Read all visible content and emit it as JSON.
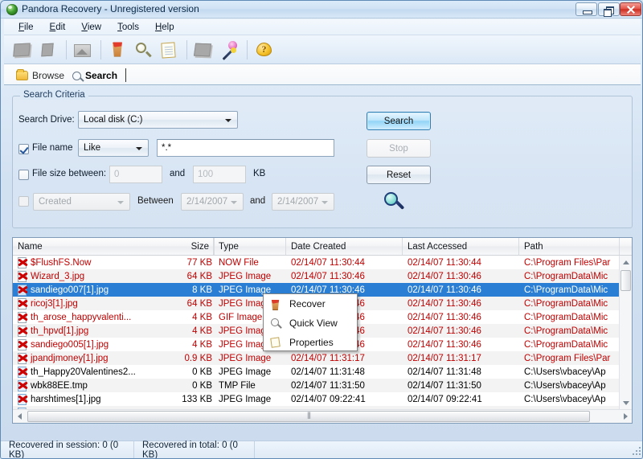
{
  "window": {
    "title": "Pandora Recovery - Unregistered version",
    "icon": "pandora-globe-icon",
    "controls": {
      "minimize": "minimize-button",
      "maximize": "maximize-button",
      "close": "close-button"
    }
  },
  "menubar": {
    "items": [
      "File",
      "Edit",
      "View",
      "Tools",
      "Help"
    ]
  },
  "toolbar": {
    "items": [
      {
        "name": "browse-back-icon"
      },
      {
        "name": "browse-forward-icon"
      },
      {
        "name": "preview-image-icon"
      },
      {
        "name": "recover-bin-icon"
      },
      {
        "name": "quick-view-icon"
      },
      {
        "name": "properties-icon"
      },
      {
        "name": "surface-scan-icon"
      },
      {
        "name": "wizard-wand-icon"
      },
      {
        "name": "help-icon"
      }
    ]
  },
  "tabs": [
    {
      "label": "Browse",
      "icon": "folder-icon",
      "active": false
    },
    {
      "label": "Search",
      "icon": "magnifier-icon",
      "active": true
    }
  ],
  "criteria": {
    "legend": "Search Criteria",
    "drive_label": "Search Drive:",
    "drive_value": "Local disk (C:)",
    "filename_label": "File name",
    "filename_checked": true,
    "filename_match": "Like",
    "filename_value": "*.*",
    "filesize_label": "File size between:",
    "filesize_checked": false,
    "filesize_min": "0",
    "filesize_and": "and",
    "filesize_max": "100",
    "filesize_unit": "KB",
    "date_checked": false,
    "date_field": "Created",
    "date_between": "Between",
    "date_from": "2/14/2007",
    "date_and": "and",
    "date_to": "2/14/2007",
    "buttons": {
      "search": "Search",
      "stop": "Stop",
      "reset": "Reset"
    },
    "magnifier_icon": "big-magnifier-icon"
  },
  "listview": {
    "columns": [
      "Name",
      "Size",
      "Type",
      "Date Created",
      "Last Accessed",
      "Path"
    ],
    "rows": [
      {
        "name": "$FlushFS.Now",
        "size": "77 KB",
        "type": "NOW File",
        "created": "02/14/07 11:30:44",
        "accessed": "02/14/07 11:30:44",
        "path": "C:\\Program Files\\Par",
        "deleted": true,
        "selected": false
      },
      {
        "name": "Wizard_3.jpg",
        "size": "64 KB",
        "type": "JPEG Image",
        "created": "02/14/07 11:30:46",
        "accessed": "02/14/07 11:30:46",
        "path": "C:\\ProgramData\\Mic",
        "deleted": true,
        "selected": false
      },
      {
        "name": "sandiego007[1].jpg",
        "size": "8 KB",
        "type": "JPEG Image",
        "created": "02/14/07 11:30:46",
        "accessed": "02/14/07 11:30:46",
        "path": "C:\\ProgramData\\Mic",
        "deleted": true,
        "selected": true
      },
      {
        "name": "ricoj3[1].jpg",
        "size": "64 KB",
        "type": "JPEG Image",
        "created": "02/14/07 11:30:46",
        "accessed": "02/14/07 11:30:46",
        "path": "C:\\ProgramData\\Mic",
        "deleted": true,
        "selected": false
      },
      {
        "name": "th_arose_happyvalenti...",
        "size": "4 KB",
        "type": "GIF Image",
        "created": "02/14/07 11:30:46",
        "accessed": "02/14/07 11:30:46",
        "path": "C:\\ProgramData\\Mic",
        "deleted": true,
        "selected": false
      },
      {
        "name": "th_hpvd[1].jpg",
        "size": "4 KB",
        "type": "JPEG Image",
        "created": "02/14/07 11:30:46",
        "accessed": "02/14/07 11:30:46",
        "path": "C:\\ProgramData\\Mic",
        "deleted": true,
        "selected": false
      },
      {
        "name": "sandiego005[1].jpg",
        "size": "4 KB",
        "type": "JPEG Image",
        "created": "02/14/07 11:30:46",
        "accessed": "02/14/07 11:30:46",
        "path": "C:\\ProgramData\\Mic",
        "deleted": true,
        "selected": false
      },
      {
        "name": "jpandjmoney[1].jpg",
        "size": "0.9 KB",
        "type": "JPEG Image",
        "created": "02/14/07 11:31:17",
        "accessed": "02/14/07 11:31:17",
        "path": "C:\\Program Files\\Par",
        "deleted": true,
        "selected": false
      },
      {
        "name": "th_Happy20Valentines2...",
        "size": "0 KB",
        "type": "JPEG Image",
        "created": "02/14/07 11:31:48",
        "accessed": "02/14/07 11:31:48",
        "path": "C:\\Users\\vbacey\\Ap",
        "deleted": false,
        "selected": false
      },
      {
        "name": "wbk88EE.tmp",
        "size": "0 KB",
        "type": "TMP File",
        "created": "02/14/07 11:31:50",
        "accessed": "02/14/07 11:31:50",
        "path": "C:\\Users\\vbacey\\Ap",
        "deleted": false,
        "selected": false
      },
      {
        "name": "harshtimes[1].jpg",
        "size": "133 KB",
        "type": "JPEG Image",
        "created": "02/14/07 09:22:41",
        "accessed": "02/14/07 09:22:41",
        "path": "C:\\Users\\vbacey\\Ap",
        "deleted": false,
        "selected": false
      }
    ]
  },
  "context_menu": {
    "items": [
      {
        "label": "Recover",
        "icon": "recover-bin-icon"
      },
      {
        "label": "Quick View",
        "icon": "magnifier-icon"
      },
      {
        "label": "Properties",
        "icon": "properties-note-icon"
      }
    ]
  },
  "statusbar": {
    "session": "Recovered in session: 0 (0 KB)",
    "total": "Recovered in total: 0 (0 KB)"
  }
}
